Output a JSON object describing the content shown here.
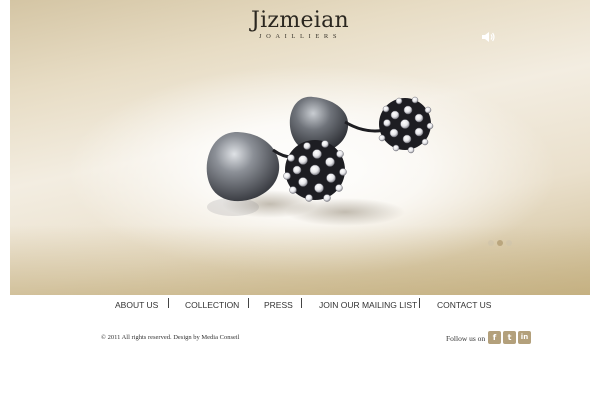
{
  "brand": {
    "name": "Jizmeian",
    "subtitle": "JOAILLIERS"
  },
  "slider": {
    "total_slides": 3,
    "active_slide": 2
  },
  "nav": {
    "items": [
      {
        "label": "ABOUT US"
      },
      {
        "label": "COLLECTION"
      },
      {
        "label": "PRESS"
      },
      {
        "label": "JOIN OUR MAILING LIST"
      },
      {
        "label": "CONTACT US"
      }
    ]
  },
  "footer": {
    "copyright": "© 2011 All rights reserved. Design by Media Conseil",
    "follow_label": "Follow us on",
    "social": [
      {
        "icon": "facebook-icon",
        "glyph": "f"
      },
      {
        "icon": "twitter-icon",
        "glyph": "t"
      },
      {
        "icon": "linkedin-icon",
        "glyph": "in"
      }
    ]
  },
  "colors": {
    "gold": "#b3a07b",
    "dot_inactive": "#d6cbb4",
    "dot_active": "#b9a57f",
    "text": "#333333"
  }
}
